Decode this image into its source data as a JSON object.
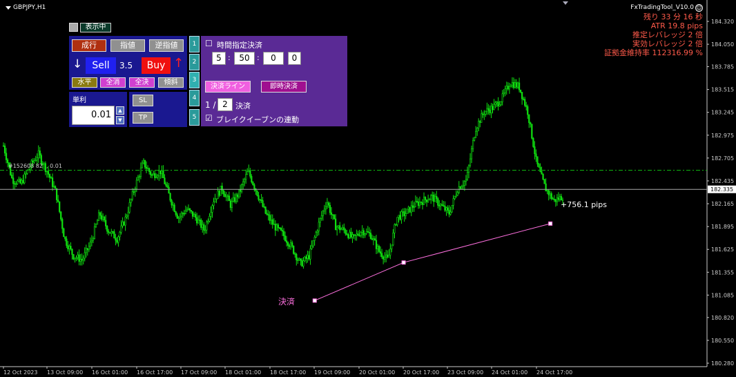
{
  "header": {
    "symbol": "GBPJPY,H1"
  },
  "info": {
    "tool_name": "FxTradingTool_V10.0",
    "lines": [
      "残り 33 分 16 秒",
      "ATR 19.8 pips",
      "推定レバレッジ 2 倍",
      "実効レバレッジ 2 倍",
      "証拠金維持率 112316.99 %"
    ]
  },
  "toggle": {
    "label": "表示中"
  },
  "order_panel": {
    "market_label": "成行",
    "limit_label": "指値",
    "stop_label": "逆指値",
    "sell_label": "Sell",
    "spread": "3.5",
    "buy_label": "Buy",
    "horizontal_label": "水平",
    "close_all_label": "全消",
    "settle_all_label": "全決",
    "slope_label": "傾斜",
    "unit_label": "単利",
    "lot_value": "0.01",
    "sl_label": "SL",
    "tp_label": "TP",
    "down_arrow": "↓",
    "up_arrow": "↑",
    "spin_up": "▲",
    "spin_down": "▼"
  },
  "tabs": [
    "1",
    "2",
    "3",
    "4",
    "5"
  ],
  "settle_panel": {
    "time_checkbox_mark": "☐",
    "time_label": "時間指定決済",
    "hour": "5",
    "minute": "50",
    "second": "0",
    "extra": "0",
    "sep": ":",
    "settle_line_label": "決済ライン",
    "instant_settle_label": "即時決済",
    "fraction_prefix": "1 /",
    "fraction_value": "2",
    "fraction_suffix": "決済",
    "breakeven_checkbox_mark": "☑",
    "breakeven_label": "ブレイクイーブンの連動"
  },
  "annotations": {
    "order_line": "#152608 82  , 0.01",
    "pips_label": "+756.1 pips",
    "settle_label": "決済"
  },
  "chart_data": {
    "type": "candlestick",
    "symbol": "GBPJPY",
    "timeframe": "H1",
    "y_ticks": [
      "184.320",
      "184.050",
      "183.785",
      "183.515",
      "183.245",
      "182.975",
      "182.705",
      "182.435",
      "182.165",
      "181.895",
      "181.625",
      "181.355",
      "181.085",
      "180.820",
      "180.550",
      "180.280"
    ],
    "y_tick_values": [
      184.32,
      184.05,
      183.785,
      183.515,
      183.245,
      182.975,
      182.705,
      182.435,
      182.165,
      181.895,
      181.625,
      181.355,
      181.085,
      180.82,
      180.55,
      180.28
    ],
    "ylim": [
      180.28,
      184.32
    ],
    "current_price": "182.335",
    "current_price_value": 182.335,
    "order_line_price": 182.56,
    "x_ticks": [
      "12 Oct 2023",
      "13 Oct 09:00",
      "16 Oct 01:00",
      "16 Oct 17:00",
      "17 Oct 09:00",
      "18 Oct 01:00",
      "18 Oct 17:00",
      "19 Oct 09:00",
      "20 Oct 01:00",
      "20 Oct 17:00",
      "23 Oct 09:00",
      "24 Oct 01:00",
      "24 Oct 17:00"
    ],
    "close_path": [
      182.85,
      182.45,
      182.4,
      182.6,
      182.75,
      182.55,
      182.3,
      181.75,
      181.55,
      181.5,
      181.7,
      182.05,
      181.85,
      181.75,
      182.0,
      182.35,
      182.65,
      182.5,
      182.55,
      182.25,
      182.0,
      182.1,
      182.0,
      181.85,
      182.2,
      182.35,
      182.15,
      182.3,
      182.55,
      182.3,
      182.05,
      181.9,
      181.8,
      181.65,
      181.45,
      181.55,
      181.9,
      182.2,
      181.9,
      181.85,
      181.75,
      181.85,
      181.8,
      181.6,
      181.5,
      182.0,
      182.05,
      182.15,
      182.2,
      182.25,
      182.15,
      182.05,
      182.35,
      182.45,
      183.05,
      183.25,
      183.3,
      183.4,
      183.6,
      183.55,
      183.25,
      182.65,
      182.35,
      182.2,
      182.25
    ],
    "settle_line": [
      [
        14.0,
        181.02
      ],
      [
        18.0,
        181.47
      ],
      [
        24.6,
        181.93
      ]
    ]
  }
}
